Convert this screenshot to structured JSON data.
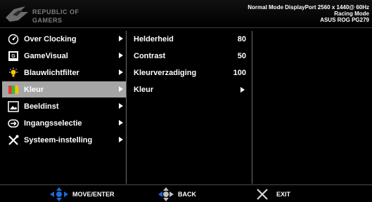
{
  "header": {
    "logo_line1": "REPUBLIC OF",
    "logo_line2": "GAMERS",
    "status": {
      "line1": "Normal Mode DisplayPort 2560 x 1440@ 60Hz",
      "line2": "Racing Mode",
      "line3": "ASUS ROG PG279"
    }
  },
  "main_menu": [
    {
      "label": "Over Clocking",
      "icon": "gauge-icon"
    },
    {
      "label": "GameVisual",
      "icon": "gamevisual-icon"
    },
    {
      "label": "Blauwlichtfilter",
      "icon": "lightbulb-icon"
    },
    {
      "label": "Kleur",
      "icon": "color-icon",
      "selected": true
    },
    {
      "label": "Beeldinst",
      "icon": "image-icon"
    },
    {
      "label": "Ingangsselectie",
      "icon": "input-icon"
    },
    {
      "label": "Systeem-instelling",
      "icon": "tools-icon"
    }
  ],
  "sub_menu": [
    {
      "label": "Helderheid",
      "value": "80"
    },
    {
      "label": "Contrast",
      "value": "50"
    },
    {
      "label": "Kleurverzadiging",
      "value": "100"
    },
    {
      "label": "Kleur",
      "value": ""
    }
  ],
  "footer": {
    "move_label": "MOVE/ENTER",
    "back_label": "BACK",
    "exit_label": "EXIT"
  },
  "colors": {
    "background": "#000000",
    "selected_bg": "#a5a5a5",
    "joystick_blue": "#1e6ad8",
    "exit_red": "#d4d4d4"
  }
}
